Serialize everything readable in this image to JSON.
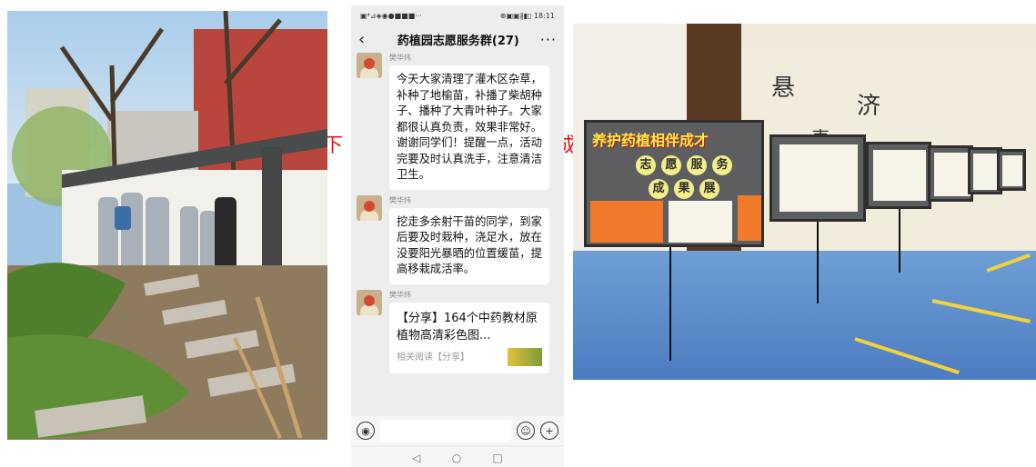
{
  "overlay_text": {
    "left": "下",
    "right": "成"
  },
  "chat": {
    "status_left": "▣⁴⊿◈◉●■■■···",
    "status_right": "⊕▣▣∦▮▯ 18:11",
    "nav": {
      "back": "‹",
      "title": "药植园志愿服务群(27)",
      "more": "···"
    },
    "messages": [
      {
        "sender": "樊华炜",
        "text": "今天大家清理了灌木区杂草，补种了地榆苗，补播了柴胡种子、播种了大青叶种子。大家都很认真负责，效果非常好。谢谢同学们！提醒一点，活动完要及时认真洗手，注意清洁卫生。"
      },
      {
        "sender": "樊华炜",
        "text": "挖走多余射干苗的同学，到家后要及时栽种，浇足水，放在没要阳光暴晒的位置缓苗，提高移栽成活率。"
      },
      {
        "sender": "樊华炜",
        "share_title": "【分享】164个中药教材原植物高清彩色图...",
        "share_sub": "相关阅读【分享】"
      }
    ],
    "input": {
      "voice_icon": "◉",
      "emoji_icon": "☺",
      "plus_icon": "+"
    },
    "sysnav": {
      "back": "◁",
      "home": "○",
      "recent": "□"
    }
  },
  "exhibit": {
    "board_title": "养护药植相伴成才",
    "board_sub1": [
      "志",
      "愿",
      "服",
      "务"
    ],
    "board_sub2": [
      "成",
      "果",
      "展"
    ],
    "calligraphy": [
      "悬",
      "壶",
      "济"
    ]
  }
}
